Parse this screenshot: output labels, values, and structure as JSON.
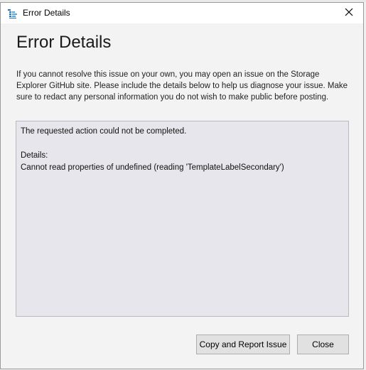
{
  "window": {
    "title": "Error Details",
    "app_icon": "storage-explorer-icon",
    "close_icon": "close-icon"
  },
  "main": {
    "heading": "Error Details",
    "description": "If you cannot resolve this issue on your own, you may open an issue on the Storage Explorer GitHub site. Please include the details below to help us diagnose your issue. Make sure to redact any personal information you do not wish to make public before posting.",
    "details": {
      "line1": "The requested action could not be completed.",
      "line2": "",
      "line3": "Details:",
      "line4": "Cannot read properties of undefined (reading 'TemplateLabelSecondary')"
    }
  },
  "footer": {
    "report_label": "Copy and Report Issue",
    "close_label": "Close"
  }
}
